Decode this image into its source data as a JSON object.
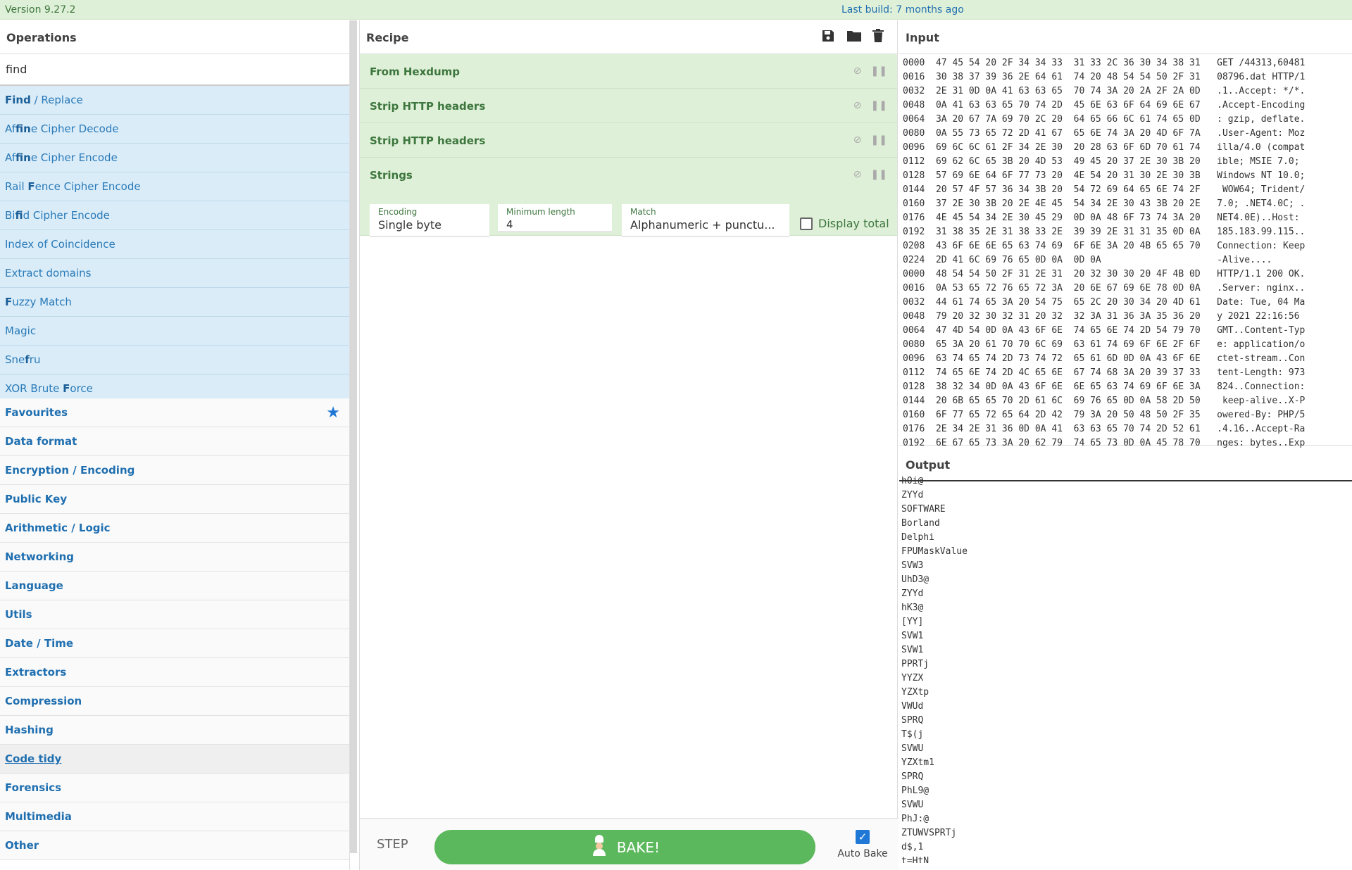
{
  "topbar": {
    "version": "Version 9.27.2",
    "last_build": "Last build: 7 months ago"
  },
  "operations": {
    "title": "Operations",
    "search_value": "find",
    "results": [
      {
        "pre": "",
        "bold": "Find",
        "post": " / Replace"
      },
      {
        "pre": "Af",
        "bold": "fin",
        "post": "e Cipher Decode"
      },
      {
        "pre": "Af",
        "bold": "fin",
        "post": "e Cipher Encode"
      },
      {
        "pre": "Rail ",
        "bold": "F",
        "post": "ence Cipher Encode"
      },
      {
        "pre": "Bi",
        "bold": "fi",
        "post": "d Cipher Encode"
      },
      {
        "pre": "Index of Coincidence",
        "bold": "",
        "post": ""
      },
      {
        "pre": "Extract domains",
        "bold": "",
        "post": ""
      },
      {
        "pre": "",
        "bold": "F",
        "post": "uzzy Match"
      },
      {
        "pre": "Magic",
        "bold": "",
        "post": ""
      },
      {
        "pre": "Sne",
        "bold": "f",
        "post": "ru"
      },
      {
        "pre": "XOR Brute ",
        "bold": "F",
        "post": "orce"
      }
    ],
    "categories": [
      "Favourites",
      "Data format",
      "Encryption / Encoding",
      "Public Key",
      "Arithmetic / Logic",
      "Networking",
      "Language",
      "Utils",
      "Date / Time",
      "Extractors",
      "Compression",
      "Hashing",
      "Code tidy",
      "Forensics",
      "Multimedia",
      "Other"
    ]
  },
  "recipe": {
    "title": "Recipe",
    "ingredients": [
      "From Hexdump",
      "Strip HTTP headers",
      "Strip HTTP headers",
      "Strings"
    ],
    "strings_args": {
      "encoding_label": "Encoding",
      "encoding_value": "Single byte",
      "minlen_label": "Minimum length",
      "minlen_value": "4",
      "match_label": "Match",
      "match_value": "Alphanumeric + punctu...",
      "display_total": "Display total"
    },
    "step_label": "STEP",
    "bake_label": "BAKE!",
    "autobake_label": "Auto Bake"
  },
  "input": {
    "title": "Input",
    "lines": [
      "0000  47 45 54 20 2F 34 34 33  31 33 2C 36 30 34 38 31   GET /44313,60481",
      "0016  30 38 37 39 36 2E 64 61  74 20 48 54 54 50 2F 31   08796.dat HTTP/1",
      "0032  2E 31 0D 0A 41 63 63 65  70 74 3A 20 2A 2F 2A 0D   .1..Accept: */*.",
      "0048  0A 41 63 63 65 70 74 2D  45 6E 63 6F 64 69 6E 67   .Accept-Encoding",
      "0064  3A 20 67 7A 69 70 2C 20  64 65 66 6C 61 74 65 0D   : gzip, deflate.",
      "0080  0A 55 73 65 72 2D 41 67  65 6E 74 3A 20 4D 6F 7A   .User-Agent: Moz",
      "0096  69 6C 6C 61 2F 34 2E 30  20 28 63 6F 6D 70 61 74   illa/4.0 (compat",
      "0112  69 62 6C 65 3B 20 4D 53  49 45 20 37 2E 30 3B 20   ible; MSIE 7.0; ",
      "0128  57 69 6E 64 6F 77 73 20  4E 54 20 31 30 2E 30 3B   Windows NT 10.0;",
      "0144  20 57 4F 57 36 34 3B 20  54 72 69 64 65 6E 74 2F    WOW64; Trident/",
      "0160  37 2E 30 3B 20 2E 4E 45  54 34 2E 30 43 3B 20 2E   7.0; .NET4.0C; .",
      "0176  4E 45 54 34 2E 30 45 29  0D 0A 48 6F 73 74 3A 20   NET4.0E)..Host: ",
      "0192  31 38 35 2E 31 38 33 2E  39 39 2E 31 31 35 0D 0A   185.183.99.115..",
      "0208  43 6F 6E 6E 65 63 74 69  6F 6E 3A 20 4B 65 65 70   Connection: Keep",
      "0224  2D 41 6C 69 76 65 0D 0A  0D 0A                     -Alive....",
      "0000  48 54 54 50 2F 31 2E 31  20 32 30 30 20 4F 4B 0D   HTTP/1.1 200 OK.",
      "0016  0A 53 65 72 76 65 72 3A  20 6E 67 69 6E 78 0D 0A   .Server: nginx..",
      "0032  44 61 74 65 3A 20 54 75  65 2C 20 30 34 20 4D 61   Date: Tue, 04 Ma",
      "0048  79 20 32 30 32 31 20 32  32 3A 31 36 3A 35 36 20   y 2021 22:16:56 ",
      "0064  47 4D 54 0D 0A 43 6F 6E  74 65 6E 74 2D 54 79 70   GMT..Content-Typ",
      "0080  65 3A 20 61 70 70 6C 69  63 61 74 69 6F 6E 2F 6F   e: application/o",
      "0096  63 74 65 74 2D 73 74 72  65 61 6D 0D 0A 43 6F 6E   ctet-stream..Con",
      "0112  74 65 6E 74 2D 4C 65 6E  67 74 68 3A 20 39 37 33   tent-Length: 973",
      "0128  38 32 34 0D 0A 43 6F 6E  6E 65 63 74 69 6F 6E 3A   824..Connection:",
      "0144  20 6B 65 65 70 2D 61 6C  69 76 65 0D 0A 58 2D 50    keep-alive..X-P",
      "0160  6F 77 65 72 65 64 2D 42  79 3A 20 50 48 50 2F 35   owered-By: PHP/5",
      "0176  2E 34 2E 31 36 0D 0A 41  63 63 65 70 74 2D 52 61   .4.16..Accept-Ra",
      "0192  6E 67 65 73 3A 20 62 79  74 65 73 0D 0A 45 78 70   nges: bytes..Exp"
    ]
  },
  "output": {
    "title": "Output",
    "lines": [
      "hOi@",
      "ZYYd",
      "SOFTWARE",
      "Borland",
      "Delphi",
      "FPUMaskValue",
      "SVW3",
      "UhD3@",
      "ZYYd",
      "hK3@",
      "[YY]",
      "SVW1",
      "SVW1",
      "PPRTj",
      "YYZX",
      "YZXtp",
      "VWUd",
      "SPRQ",
      "T$(j",
      "SVWU",
      "YZXtm1",
      "SPRQ",
      "PhL9@",
      "SVWU",
      "PhJ:@",
      "ZTUWVSPRTj",
      "d$,1",
      "t=HtN"
    ]
  },
  "colors": {
    "accent_green": "#5cb85c",
    "ingredient_bg": "#dff0d8",
    "results_bg": "#d9ecf8",
    "link_blue": "#1f6fb0"
  }
}
